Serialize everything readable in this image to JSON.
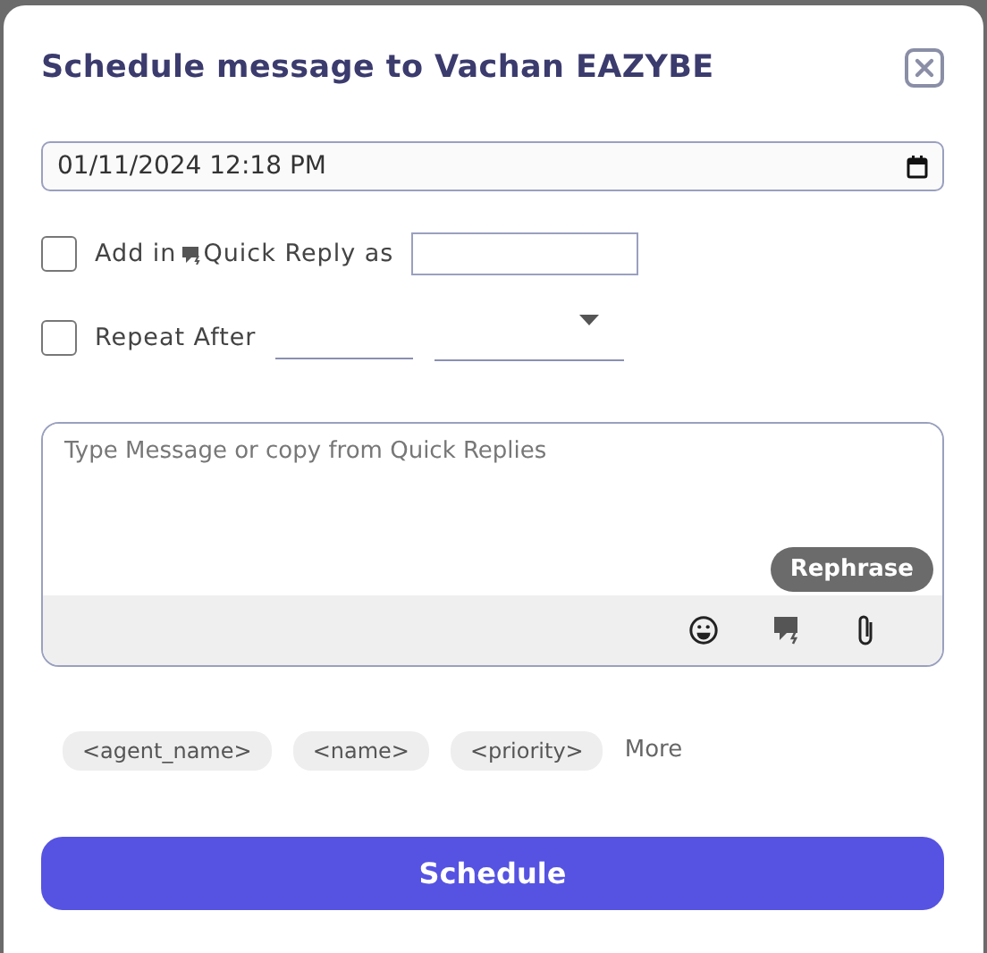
{
  "dialog": {
    "title": "Schedule message to Vachan EAZYBE"
  },
  "datetime": {
    "value": "01/11/2024 12:18 PM"
  },
  "quick_reply": {
    "checked": false,
    "label_before": "Add in",
    "label_after": "Quick Reply as"
  },
  "repeat": {
    "checked": false,
    "label": "Repeat After"
  },
  "message": {
    "placeholder": "Type Message or copy from Quick Replies",
    "rephrase_button": "Rephrase"
  },
  "variables": [
    "<agent_name>",
    "<name>",
    "<priority>"
  ],
  "more_link": "More",
  "schedule_button": "Schedule"
}
